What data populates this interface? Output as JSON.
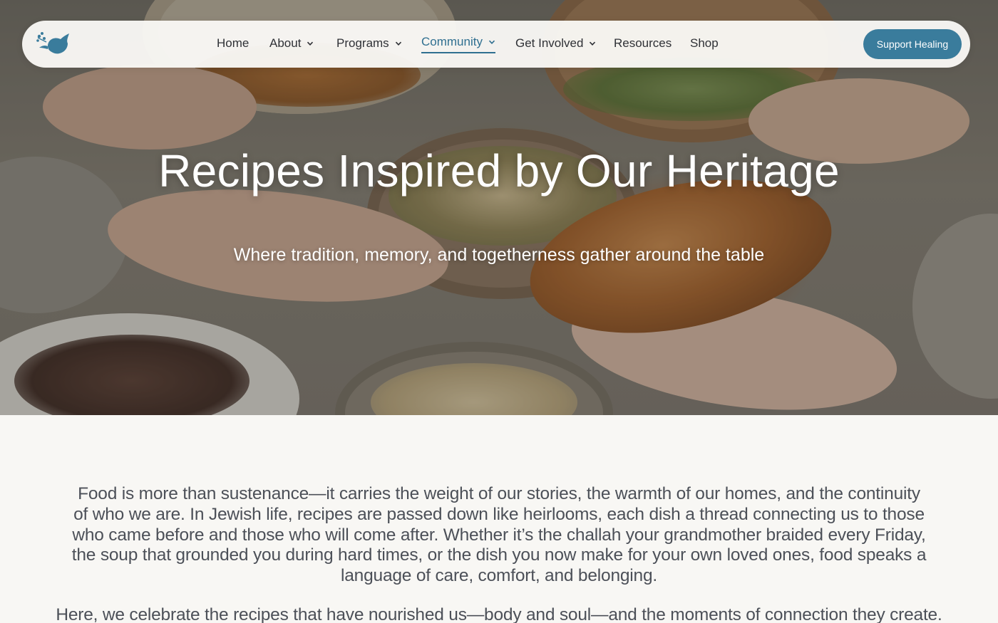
{
  "nav": {
    "logo_icon": "dove-icon",
    "items": [
      {
        "label": "Home",
        "has_dropdown": false
      },
      {
        "label": "About",
        "has_dropdown": true
      },
      {
        "label": "Programs",
        "has_dropdown": true
      },
      {
        "label": "Community",
        "has_dropdown": true,
        "active": true
      },
      {
        "label": "Get Involved",
        "has_dropdown": true
      },
      {
        "label": "Resources",
        "has_dropdown": false
      },
      {
        "label": "Shop",
        "has_dropdown": false
      }
    ],
    "cta_label": "Support Healing"
  },
  "hero": {
    "title": "Recipes Inspired by Our Heritage",
    "subtitle": "Where tradition, memory, and togetherness gather around the table"
  },
  "content": {
    "paragraph_1": "Food is more than sustenance—it carries the weight of our stories, the warmth of our homes, and the continuity of who we are. In Jewish life, recipes are passed down like heirlooms, each dish a thread connecting us to those who came before and those who will come after. Whether it’s the challah your grandmother braided every Friday, the soup that grounded you during hard times, or the dish you now make for your own loved ones, food speaks a language of care, comfort, and belonging.",
    "paragraph_2": "Here, we celebrate the recipes that have nourished us—body and soul—and the moments of connection they create."
  },
  "colors": {
    "accent": "#3a7c9c",
    "nav_active": "#2f6f90",
    "page_background": "#f8f7f4",
    "body_text": "#4c5058"
  }
}
